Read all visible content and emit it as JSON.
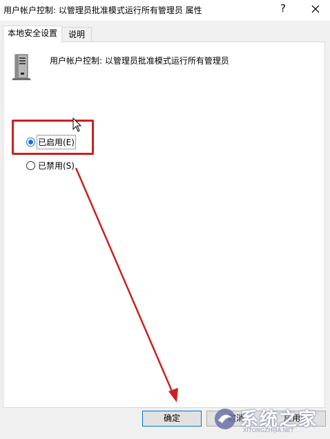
{
  "window": {
    "title": "用户帐户控制: 以管理员批准模式运行所有管理员 属性",
    "help_label": "?"
  },
  "tabs": [
    {
      "label": "本地安全设置",
      "active": true
    },
    {
      "label": "说明",
      "active": false
    }
  ],
  "policy": {
    "name": "用户帐户控制: 以管理员批准模式运行所有管理员",
    "icon": "server-tower-icon"
  },
  "options": [
    {
      "label": "已启用(E)",
      "checked": true
    },
    {
      "label": "已禁用(S)",
      "checked": false
    }
  ],
  "buttons": {
    "ok": "确定",
    "cancel": "取消",
    "apply": "应用(A)"
  },
  "annotation_color": "#cc1f1f",
  "watermark": {
    "text": "系统之家",
    "sub": "XITONGZHIJIA.NET"
  }
}
